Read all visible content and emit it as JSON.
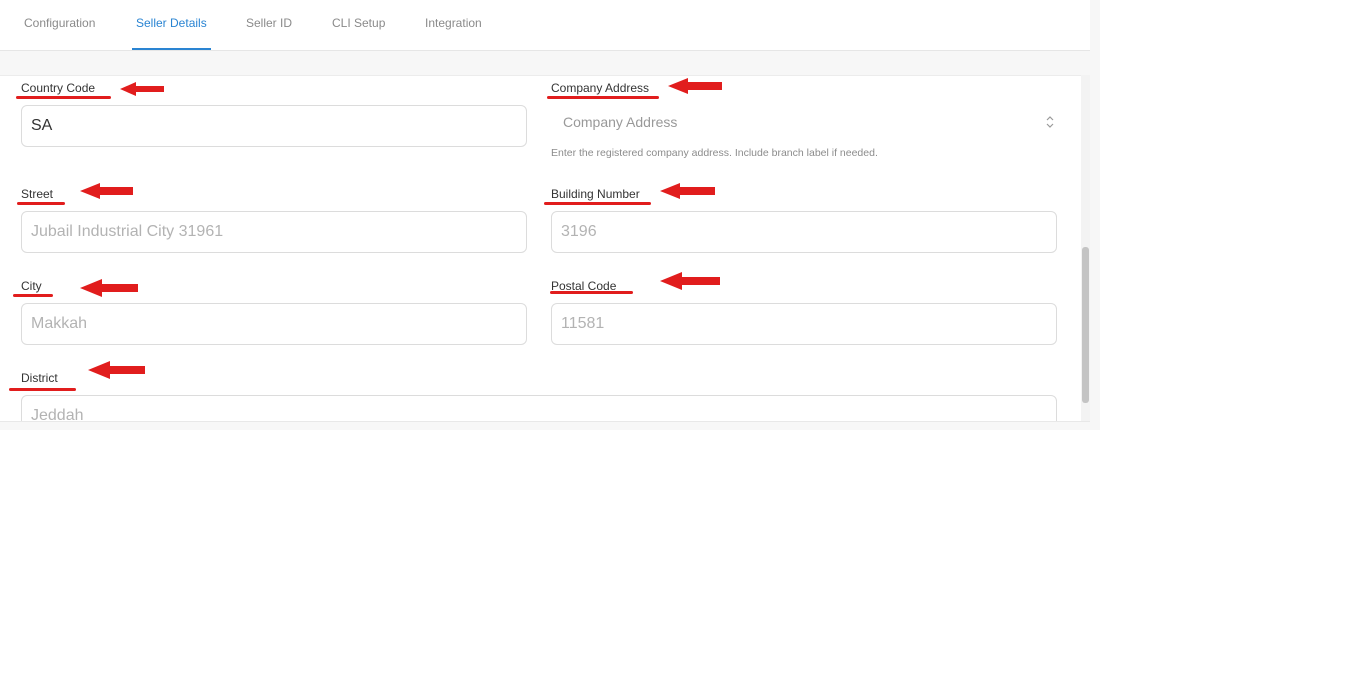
{
  "tabs": [
    {
      "label": "Configuration",
      "active": false
    },
    {
      "label": "Seller Details",
      "active": true
    },
    {
      "label": "Seller ID",
      "active": false
    },
    {
      "label": "CLI Setup",
      "active": false
    },
    {
      "label": "Integration",
      "active": false
    }
  ],
  "form": {
    "country_code": {
      "label": "Country Code",
      "value": "SA"
    },
    "company_address": {
      "label": "Company Address",
      "placeholder": "Company Address",
      "hint": "Enter the registered company address. Include branch label if needed."
    },
    "street": {
      "label": "Street",
      "placeholder": "Jubail Industrial City 31961"
    },
    "building_number": {
      "label": "Building Number",
      "placeholder": "3196"
    },
    "city": {
      "label": "City",
      "placeholder": "Makkah"
    },
    "postal_code": {
      "label": "Postal Code",
      "placeholder": "11581"
    },
    "district": {
      "label": "District",
      "placeholder": "Jeddah"
    }
  },
  "colors": {
    "accent": "#2a84d2",
    "annotation": "#e11d1d"
  },
  "annotation_icon": "red-arrow-left-icon"
}
